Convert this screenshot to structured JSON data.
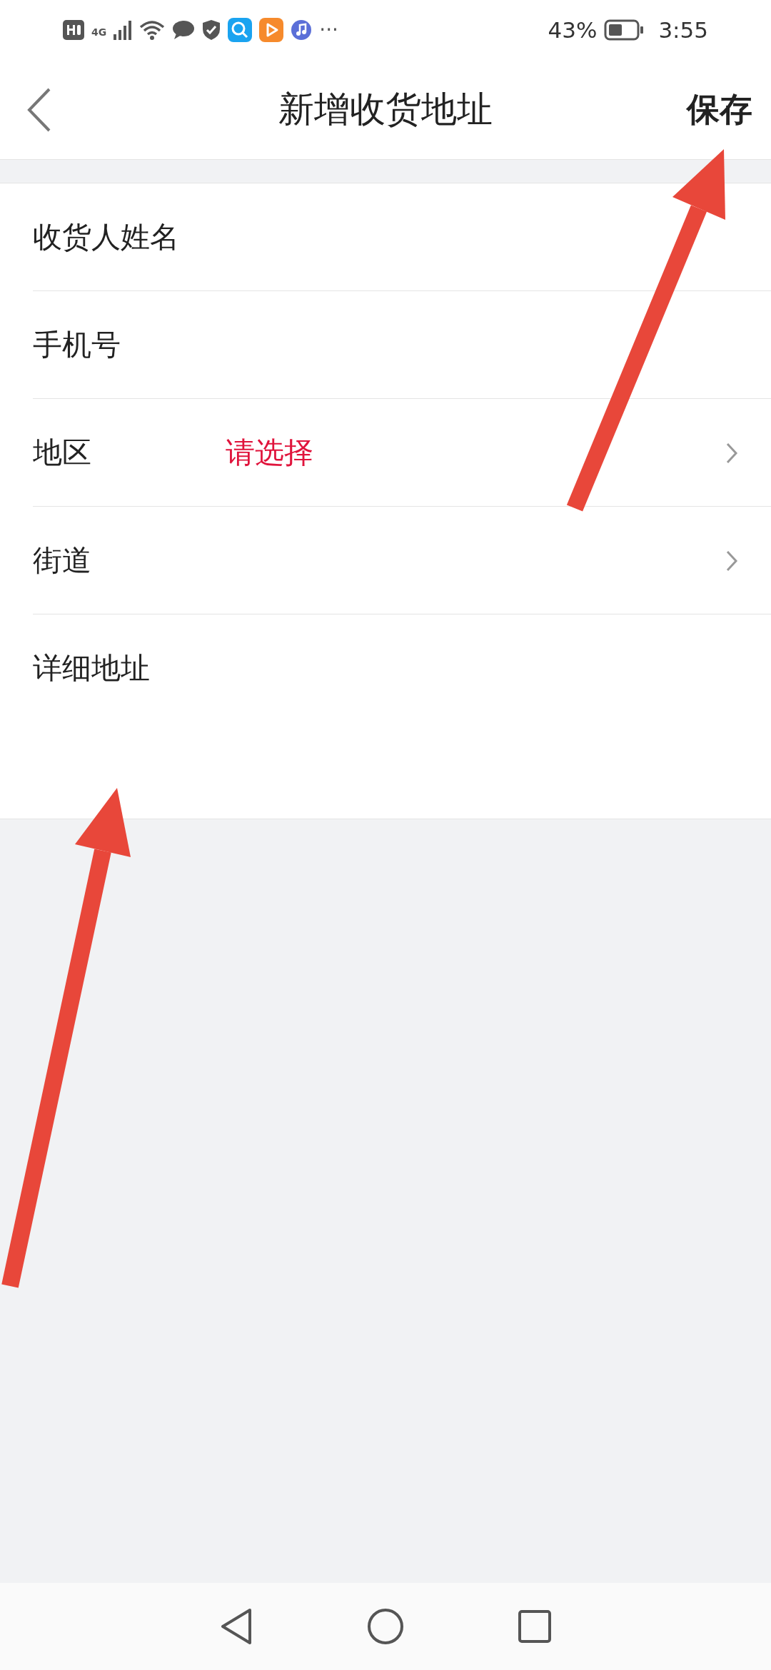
{
  "status_bar": {
    "network": "4G",
    "more": "···",
    "battery_percent": "43%",
    "time": "3:55"
  },
  "header": {
    "title": "新增收货地址",
    "action": "保存"
  },
  "form": {
    "rows": [
      {
        "kind": "text",
        "label": "收货人姓名"
      },
      {
        "kind": "text",
        "label": "手机号"
      },
      {
        "kind": "select",
        "label": "地区",
        "prompt": "请选择"
      },
      {
        "kind": "select",
        "label": "街道"
      },
      {
        "kind": "textarea",
        "label": "详细地址"
      }
    ]
  }
}
